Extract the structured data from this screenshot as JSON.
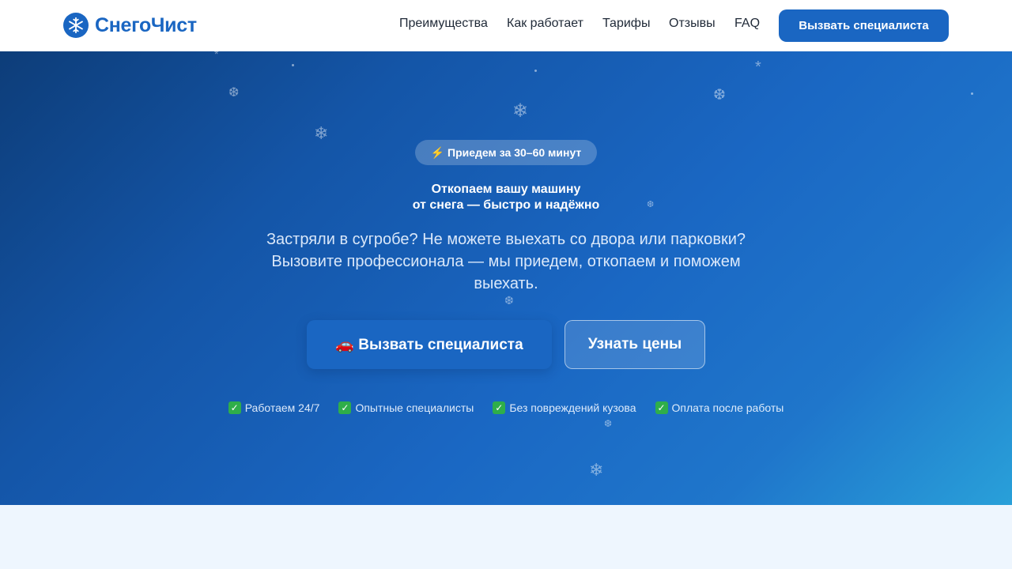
{
  "brand": {
    "name": "СнегоЧист",
    "icon": "snowflake-icon",
    "color": "#1a66c2"
  },
  "nav": {
    "items": [
      "Преимущества",
      "Как работает",
      "Тарифы",
      "Отзывы",
      "FAQ"
    ],
    "cta": "Вызвать специалиста"
  },
  "hero": {
    "badge": "⚡ Приедем за 30–60 минут",
    "title_line1": "Откопаем вашу машину",
    "title_line2": "от снега — быстро и надёжно",
    "subtitle": "Застряли в сугробе? Не можете выехать со двора или парковки? Вызовите профессионала — мы приедем, откопаем и поможем выехать.",
    "primary_button": "🚗 Вызвать специалиста",
    "secondary_button": "Узнать цены",
    "features": [
      "Работаем 24/7",
      "Опытные специалисты",
      "Без повреждений кузова",
      "Оплата после работы"
    ]
  },
  "colors": {
    "accent": "#1a66c2",
    "hero_start": "#0d3d79",
    "hero_end": "#29a0d9",
    "check": "#2fae4a",
    "page_bg": "#eef6fe"
  }
}
